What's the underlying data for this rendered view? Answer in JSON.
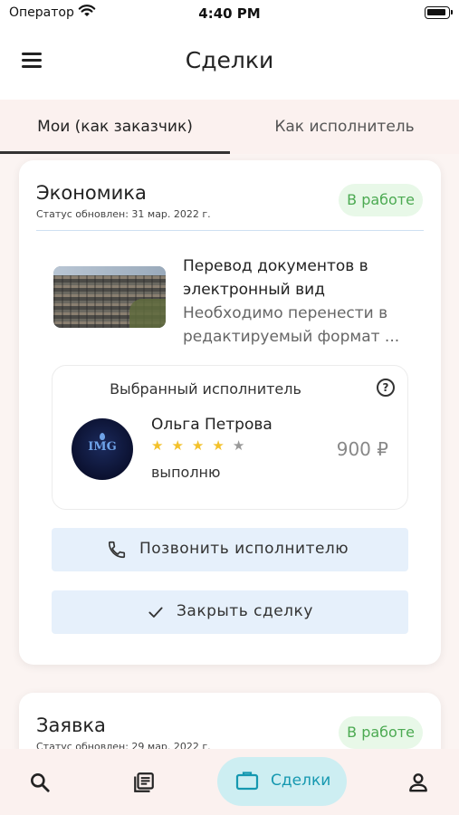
{
  "status_bar": {
    "carrier": "Оператор",
    "time": "4:40 PM"
  },
  "header": {
    "title": "Сделки"
  },
  "tabs": [
    {
      "label": "Мои (как заказчик)",
      "active": true
    },
    {
      "label": "Как исполнитель",
      "active": false
    }
  ],
  "deals": [
    {
      "title": "Экономика",
      "status_updated": "Статус обновлен: 31 мар. 2022 г.",
      "status": "В работе",
      "task_title": "Перевод документов в электронный вид",
      "task_description": "Необходимо перенести в редактируемый формат ...",
      "executor_section_label": "Выбранный исполнитель",
      "executor": {
        "name": "Ольга Петрова",
        "avatar_text": "IMG",
        "rating": 4.5,
        "rating_max": 5,
        "note": "выполню",
        "price": "900 ₽"
      },
      "call_button": "Позвонить исполнителю",
      "close_button": "Закрыть сделку"
    },
    {
      "title": "Заявка",
      "status_updated": "Статус обновлен: 29 мар. 2022 г.",
      "status": "В работе"
    }
  ],
  "bottom_nav": {
    "items": [
      {
        "icon": "search-icon",
        "active": false
      },
      {
        "icon": "document-list-icon",
        "active": false
      },
      {
        "icon": "briefcase-icon",
        "label": "Сделки",
        "active": true
      },
      {
        "icon": "profile-icon",
        "active": false
      }
    ]
  },
  "colors": {
    "status_green": "#4caa52",
    "status_green_bg": "#e8f8e8",
    "button_bg": "#e6f0fb",
    "nav_active_bg": "#cdeef2",
    "nav_active_text": "#1598b0",
    "star": "#f3c12a"
  }
}
